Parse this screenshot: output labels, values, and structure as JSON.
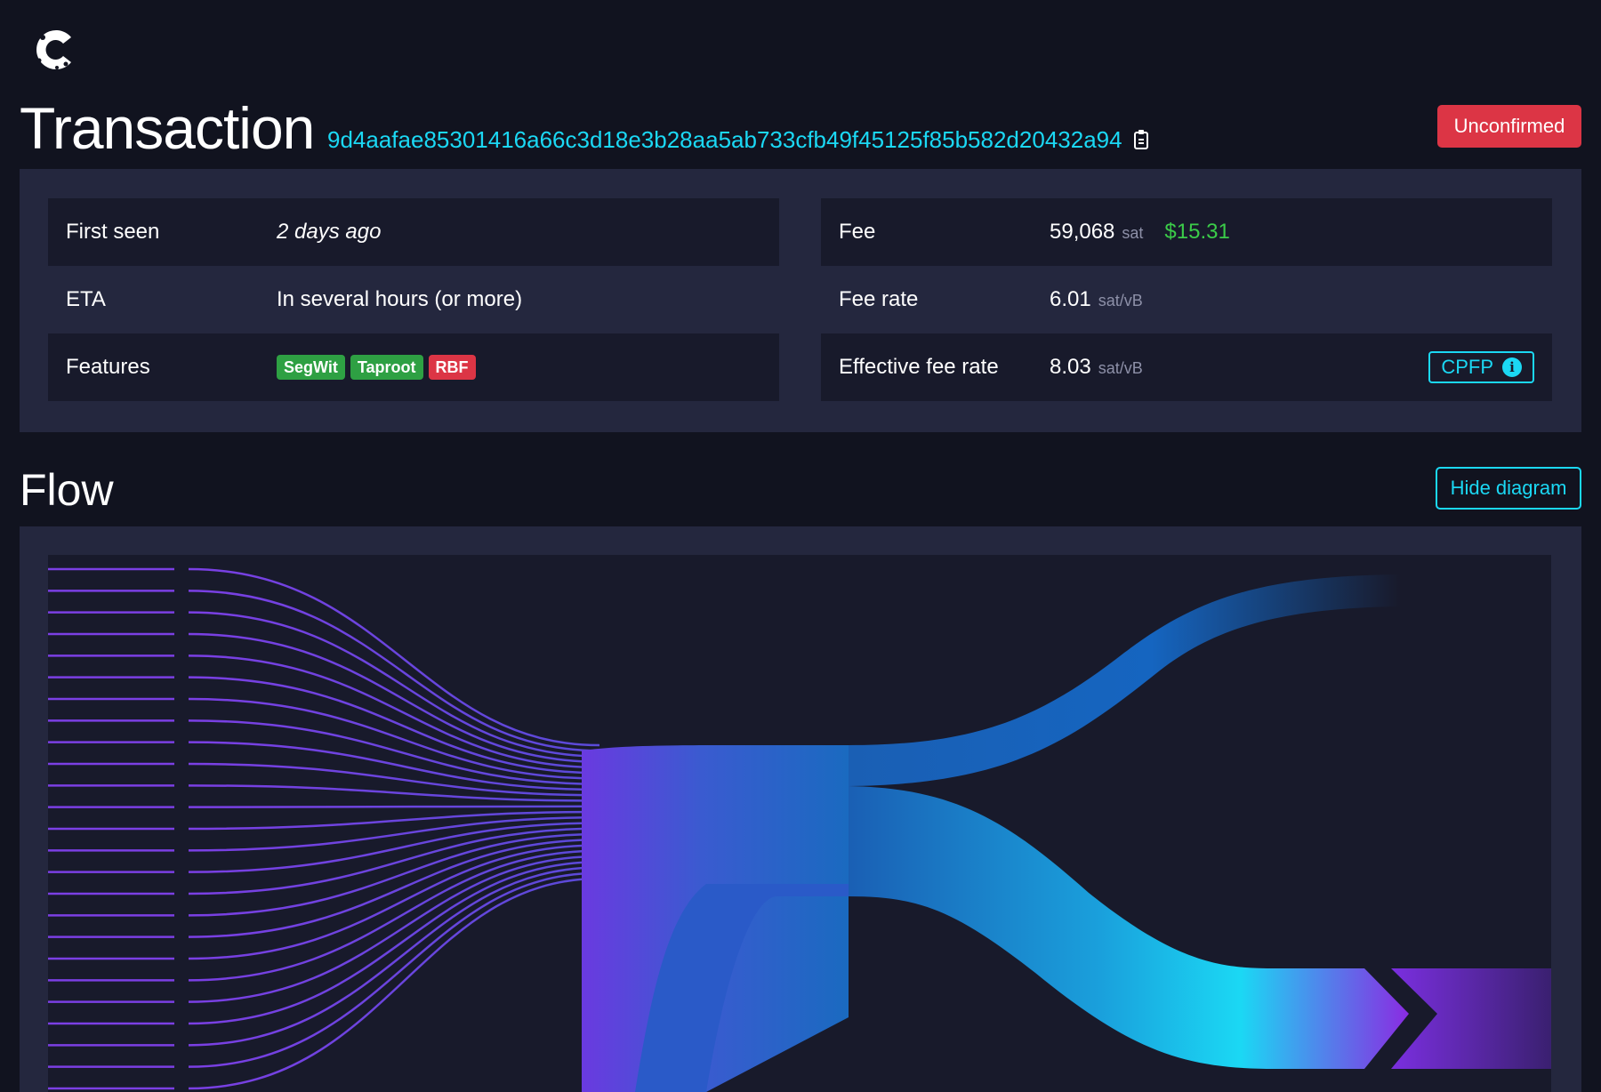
{
  "header": {
    "logo_icon": "mempool-logo-icon",
    "title": "Transaction",
    "txid": "9d4aafae85301416a66c3d18e3b28aa5ab733cfb49f45125f85b582d20432a94",
    "copy_icon": "clipboard-icon",
    "status": "Unconfirmed",
    "status_color": "#dc3545"
  },
  "details": {
    "left": [
      {
        "label": "First seen",
        "value": "2 days ago"
      },
      {
        "label": "ETA",
        "value": "In several hours (or more)"
      },
      {
        "label": "Features",
        "badges": [
          {
            "text": "SegWit",
            "color": "#2ea043"
          },
          {
            "text": "Taproot",
            "color": "#2ea043"
          },
          {
            "text": "RBF",
            "color": "#dc3545"
          }
        ]
      }
    ],
    "right": [
      {
        "label": "Fee",
        "value": "59,068",
        "unit": "sat",
        "fiat": "$15.31"
      },
      {
        "label": "Fee rate",
        "value": "6.01",
        "unit": "sat/vB"
      },
      {
        "label": "Effective fee rate",
        "value": "8.03",
        "unit": "sat/vB",
        "button": "CPFP",
        "button_icon": "info-icon"
      }
    ]
  },
  "flow": {
    "title": "Flow",
    "hide_label": "Hide diagram",
    "input_count": 25,
    "accent_colors": {
      "input": "#7b3fe4",
      "mid": "#1a5fb4",
      "output": "#1bd8f4",
      "change": "#8a2be2"
    }
  }
}
